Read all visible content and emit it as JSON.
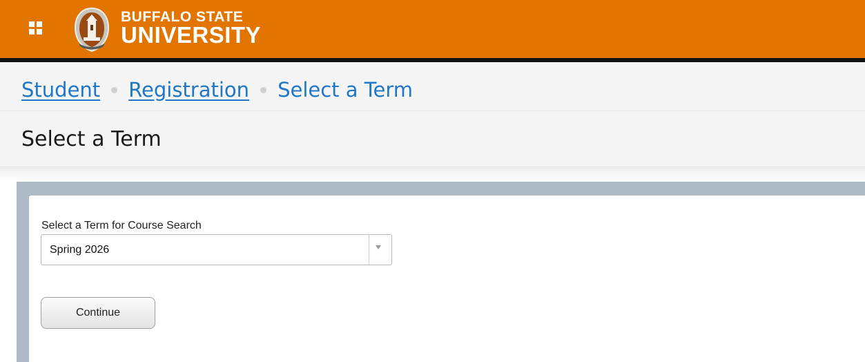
{
  "header": {
    "logo_line1": "BUFFALO STATE",
    "logo_line2": "UNIVERSITY",
    "menu_icon": "app-grid-icon",
    "seal_icon": "university-seal-icon",
    "brand_color": "#e27500"
  },
  "breadcrumb": {
    "items": [
      {
        "label": "Student",
        "link": true
      },
      {
        "label": "Registration",
        "link": true
      },
      {
        "label": "Select a Term",
        "link": false
      }
    ],
    "color": "#1f77c6"
  },
  "page": {
    "title": "Select a Term"
  },
  "form": {
    "term_label": "Select a Term for Course Search",
    "term_selected": "Spring 2026",
    "dropdown_icon": "chevron-down-icon",
    "continue_label": "Continue"
  }
}
